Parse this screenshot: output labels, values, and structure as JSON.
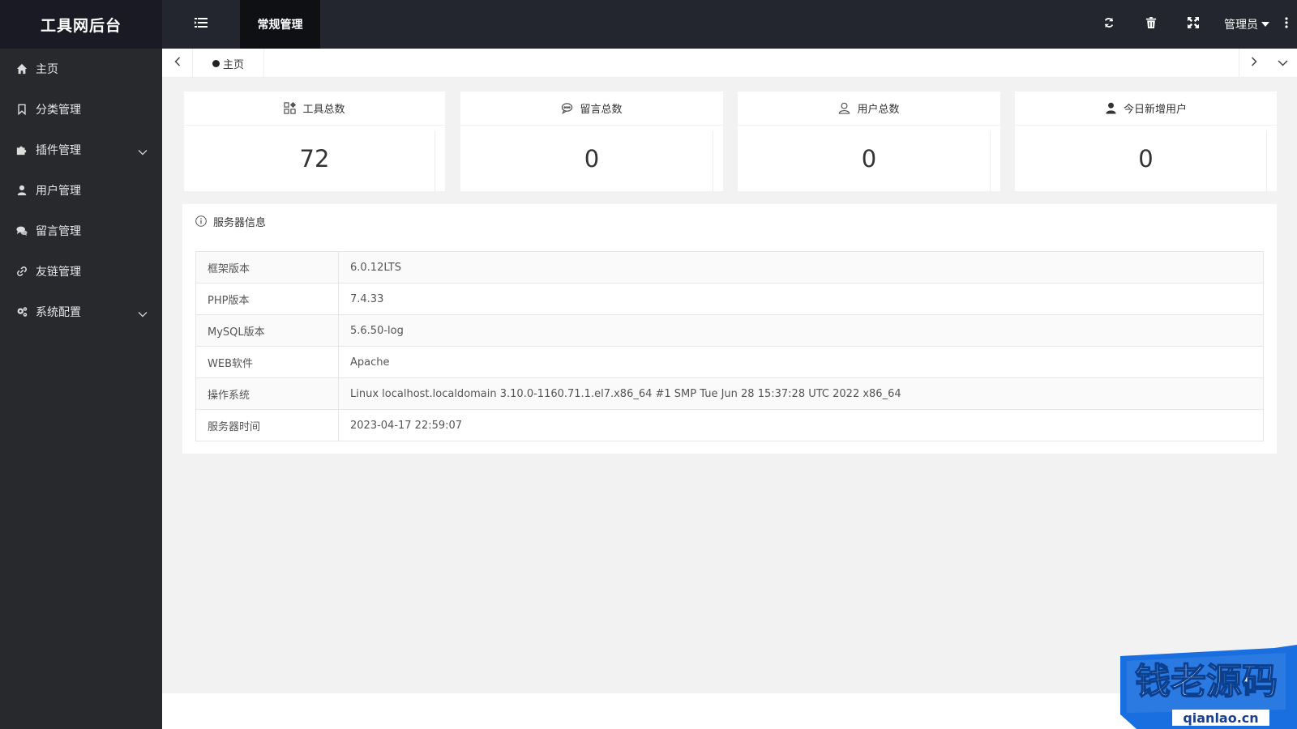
{
  "app": {
    "title": "工具网后台"
  },
  "header": {
    "top_tab": "常规管理",
    "admin_label": "管理员",
    "icons": [
      "menu-icon",
      "refresh-icon",
      "trash-icon",
      "fullscreen-icon",
      "more-vertical-icon"
    ]
  },
  "sidebar": {
    "items": [
      {
        "label": "主页",
        "icon": "home-icon",
        "has_children": false
      },
      {
        "label": "分类管理",
        "icon": "bookmark-icon",
        "has_children": false
      },
      {
        "label": "插件管理",
        "icon": "puzzle-icon",
        "has_children": true
      },
      {
        "label": "用户管理",
        "icon": "user-icon",
        "has_children": false
      },
      {
        "label": "留言管理",
        "icon": "comments-icon",
        "has_children": false
      },
      {
        "label": "友链管理",
        "icon": "link-icon",
        "has_children": false
      },
      {
        "label": "系统配置",
        "icon": "gears-icon",
        "has_children": true
      }
    ]
  },
  "tabs": {
    "home_label": "主页"
  },
  "stats": [
    {
      "label": "工具总数",
      "value": "72",
      "icon": "apps-icon"
    },
    {
      "label": "留言总数",
      "value": "0",
      "icon": "chat-icon"
    },
    {
      "label": "用户总数",
      "value": "0",
      "icon": "user-outline-icon"
    },
    {
      "label": "今日新增用户",
      "value": "0",
      "icon": "user-solid-icon"
    }
  ],
  "server": {
    "title": "服务器信息",
    "rows": [
      {
        "key": "框架版本",
        "value": "6.0.12LTS"
      },
      {
        "key": "PHP版本",
        "value": "7.4.33"
      },
      {
        "key": "MySQL版本",
        "value": "5.6.50-log"
      },
      {
        "key": "WEB软件",
        "value": "Apache"
      },
      {
        "key": "操作系统",
        "value": "Linux localhost.localdomain 3.10.0-1160.71.1.el7.x86_64 #1 SMP Tue Jun 28 15:37:28 UTC 2022 x86_64"
      },
      {
        "key": "服务器时间",
        "value": "2023-04-17 22:59:07"
      }
    ]
  },
  "watermark": {
    "brand": "钱老源码",
    "domain": "qianlao.cn"
  },
  "colors": {
    "sidebar_bg": "#28292d",
    "header_bg": "#23262e",
    "logo_bg": "#191a23",
    "active_tab_bg": "#0f1014",
    "watermark_blue": "#1a6fe0"
  }
}
